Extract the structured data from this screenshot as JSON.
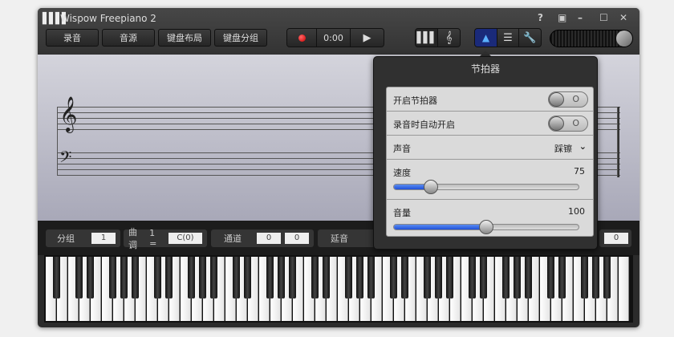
{
  "window": {
    "title": "Wispow Freepiano 2",
    "logo": "piano-keys-icon"
  },
  "toolbar": {
    "buttons": [
      "录音",
      "音源",
      "键盘布局",
      "键盘分组"
    ],
    "time": "0:00"
  },
  "window_controls": {
    "help": "?",
    "restore": "▣",
    "minimize": "–",
    "maximize": "☐",
    "close": "✕"
  },
  "controls": {
    "group_label": "分组",
    "group_value": "1",
    "key_label": "曲调",
    "key_prefix": "1 =",
    "key_value": "C(0)",
    "channel_label": "通道",
    "channel_values": [
      "0",
      "0"
    ],
    "sustain_label": "延音",
    "last_value": "0"
  },
  "metronome": {
    "title": "节拍器",
    "enable_label": "开启节拍器",
    "enable_on": false,
    "toggle_text": "O",
    "auto_label": "录音时自动开启",
    "auto_on": false,
    "sound_label": "声音",
    "sound_value": "踩镲",
    "speed_label": "速度",
    "speed_value": "75",
    "speed_fraction": 0.2,
    "volume_label": "音量",
    "volume_value": "100",
    "volume_fraction": 0.5
  },
  "colors": {
    "accent": "#1f50d8",
    "record": "#e01010",
    "active_tab": "#1a2a7a"
  }
}
